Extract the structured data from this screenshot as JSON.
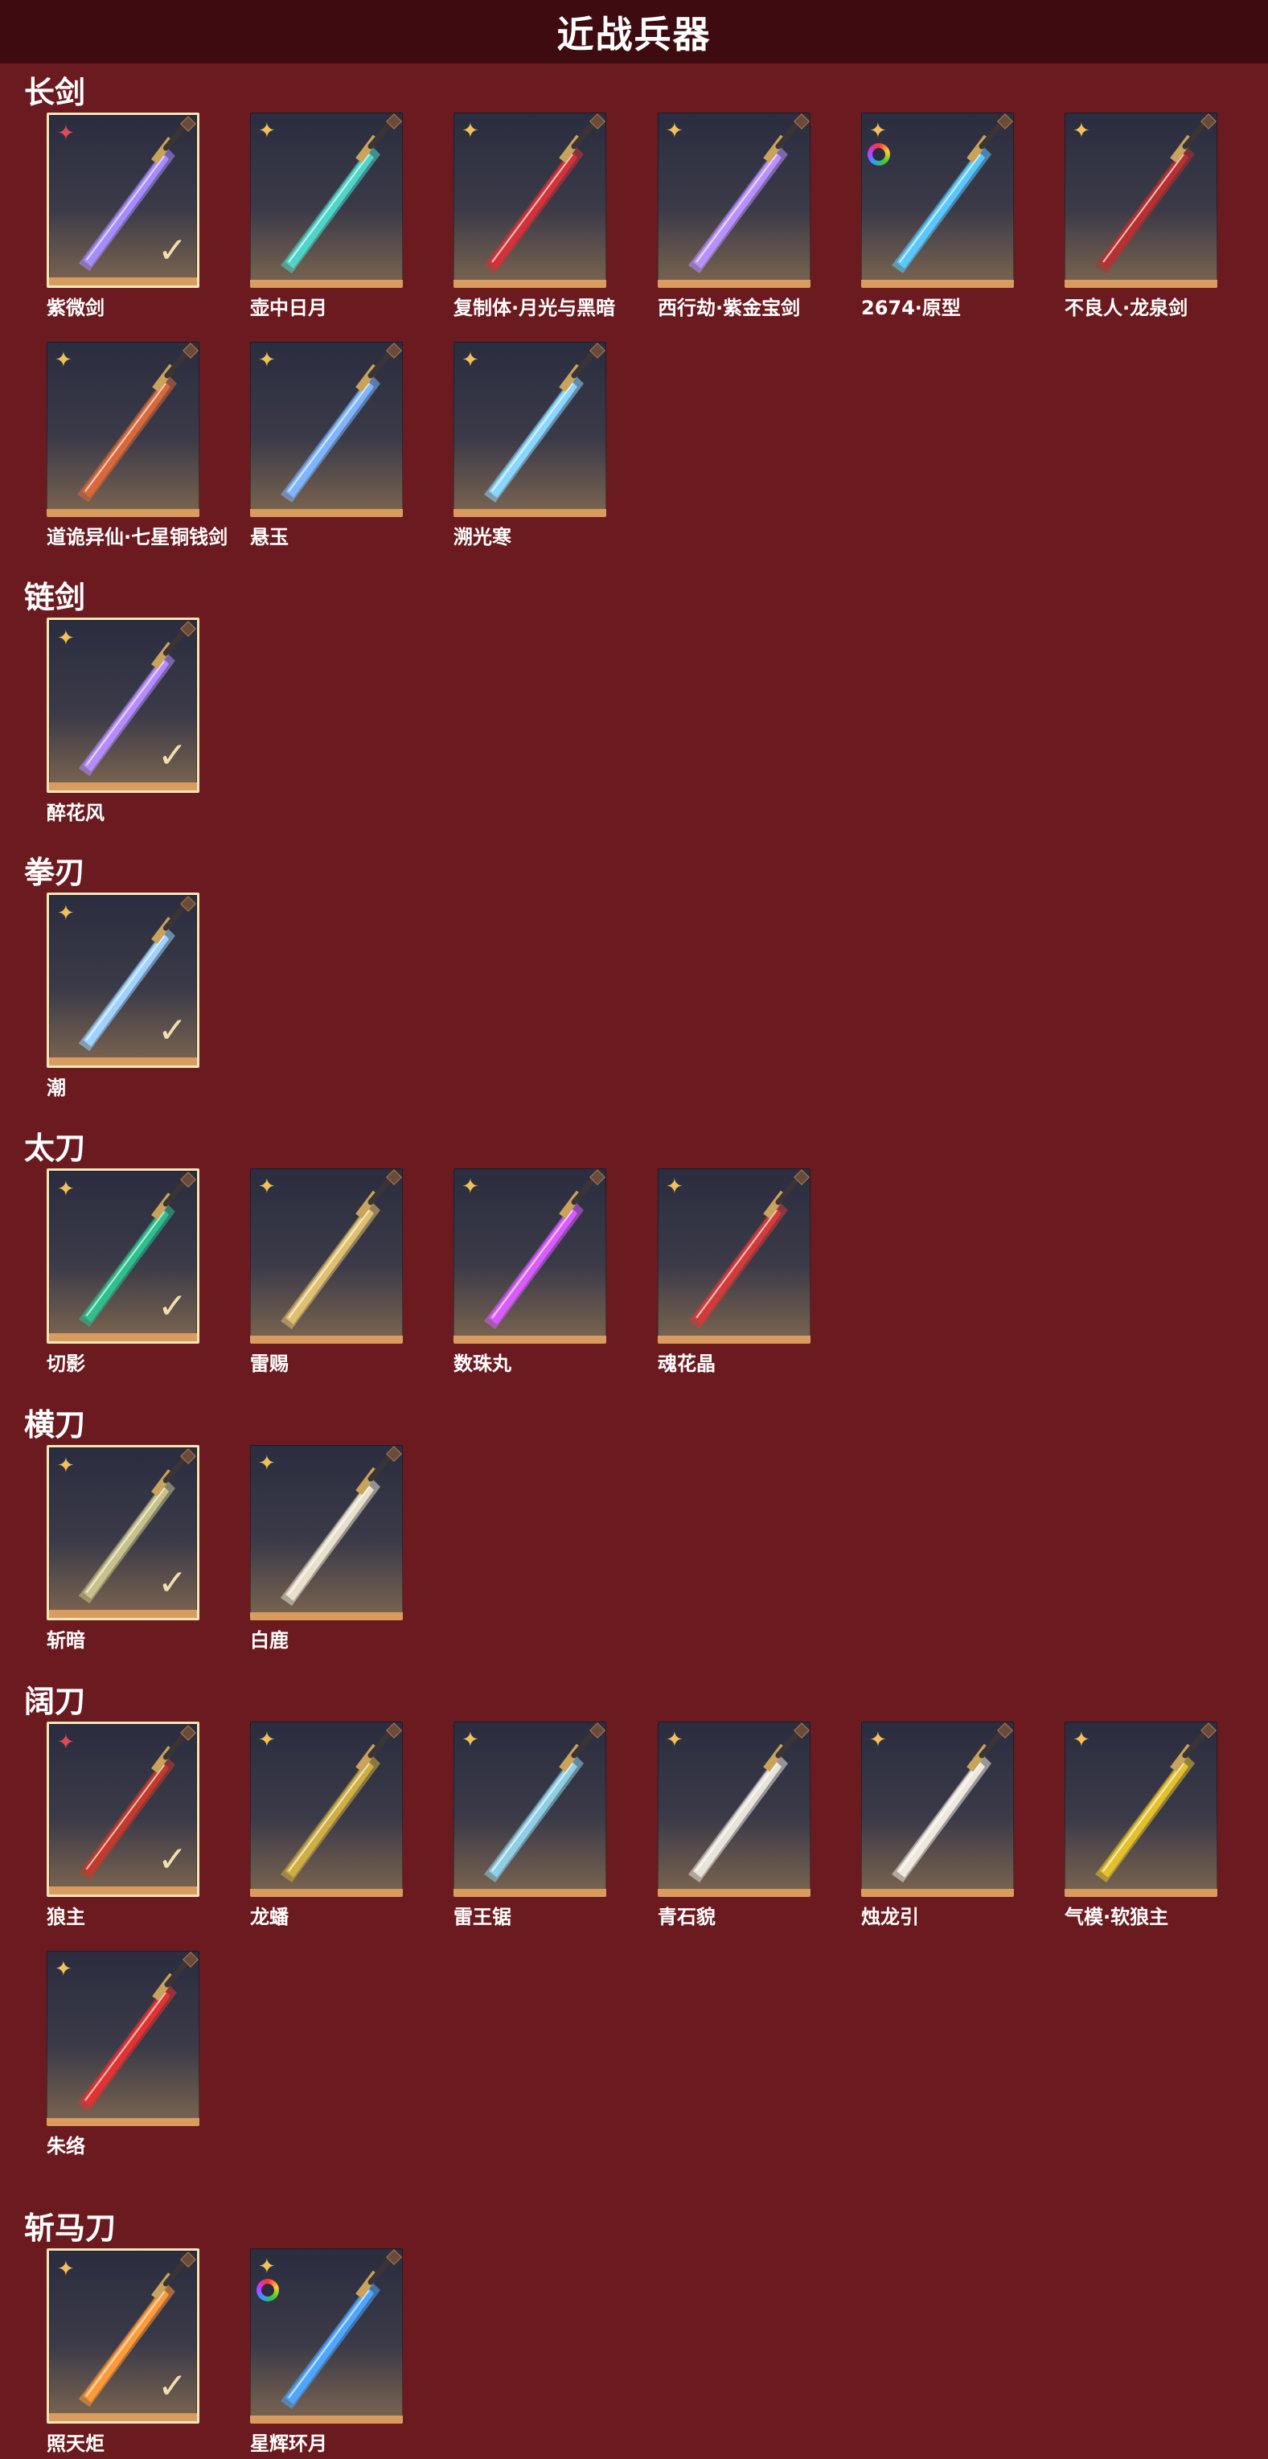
{
  "title": "近战兵器",
  "icons": {
    "rarity": "star-rarity-icon",
    "selected": "check-mark-icon",
    "ring": "rainbow-ring-icon"
  },
  "colors": {
    "background": "#6b1a1f",
    "header": "#3e0b10",
    "stripe": "#d99c5e",
    "check": "#f2dfb0",
    "rarity_gold": "#f1c05a",
    "rarity_red": "#e0495a"
  },
  "sections": [
    {
      "title": "长剑",
      "items": [
        {
          "name": "紫微剑",
          "rarity": "red",
          "selected": true,
          "ring": false,
          "color": "#a58cff"
        },
        {
          "name": "壶中日月",
          "rarity": "gold",
          "selected": false,
          "ring": false,
          "color": "#4fd5c8"
        },
        {
          "name": "复制体·月光与黑暗",
          "rarity": "gold",
          "selected": false,
          "ring": false,
          "color": "#d23238"
        },
        {
          "name": "西行劫·紫金宝剑",
          "rarity": "gold",
          "selected": false,
          "ring": false,
          "color": "#b891ff"
        },
        {
          "name": "2674·原型",
          "rarity": "gold",
          "selected": false,
          "ring": true,
          "color": "#5ac8ff"
        },
        {
          "name": "不良人·龙泉剑",
          "rarity": "gold",
          "selected": false,
          "ring": false,
          "color": "#b73030"
        },
        {
          "name": "道诡异仙·七星铜钱剑",
          "rarity": "gold",
          "selected": false,
          "ring": false,
          "color": "#d9683a"
        },
        {
          "name": "悬玉",
          "rarity": "gold",
          "selected": false,
          "ring": false,
          "color": "#7fb4ff"
        },
        {
          "name": "溯光寒",
          "rarity": "gold",
          "selected": false,
          "ring": false,
          "color": "#8ad6ff"
        }
      ]
    },
    {
      "title": "链剑",
      "items": [
        {
          "name": "醉花风",
          "rarity": "gold",
          "selected": true,
          "ring": false,
          "color": "#b58cff"
        }
      ]
    },
    {
      "title": "拳刃",
      "items": [
        {
          "name": "潮",
          "rarity": "gold",
          "selected": true,
          "ring": false,
          "color": "#9fd2ff"
        }
      ]
    },
    {
      "title": "太刀",
      "items": [
        {
          "name": "切影",
          "rarity": "gold",
          "selected": true,
          "ring": false,
          "color": "#2fbf8f"
        },
        {
          "name": "雷赐",
          "rarity": "gold",
          "selected": false,
          "ring": false,
          "color": "#e0c070"
        },
        {
          "name": "数珠丸",
          "rarity": "gold",
          "selected": false,
          "ring": false,
          "color": "#d85cff"
        },
        {
          "name": "魂花晶",
          "rarity": "gold",
          "selected": false,
          "ring": false,
          "color": "#d33a3a"
        }
      ]
    },
    {
      "title": "横刀",
      "items": [
        {
          "name": "斩暗",
          "rarity": "gold",
          "selected": true,
          "ring": false,
          "color": "#c7c28a"
        },
        {
          "name": "白鹿",
          "rarity": "gold",
          "selected": false,
          "ring": false,
          "color": "#e8e0cc"
        }
      ]
    },
    {
      "title": "阔刀",
      "items": [
        {
          "name": "狼主",
          "rarity": "red",
          "selected": true,
          "ring": false,
          "color": "#c23a2c"
        },
        {
          "name": "龙蟠",
          "rarity": "gold",
          "selected": false,
          "ring": false,
          "color": "#cfae43"
        },
        {
          "name": "雷王锯",
          "rarity": "gold",
          "selected": false,
          "ring": false,
          "color": "#8fcfe6"
        },
        {
          "name": "青石貌",
          "rarity": "gold",
          "selected": false,
          "ring": false,
          "color": "#e8e4dc"
        },
        {
          "name": "烛龙引",
          "rarity": "gold",
          "selected": false,
          "ring": false,
          "color": "#efe8df"
        },
        {
          "name": "气模·软狼主",
          "rarity": "gold",
          "selected": false,
          "ring": false,
          "color": "#e4c12c"
        },
        {
          "name": "朱络",
          "rarity": "gold",
          "selected": false,
          "ring": false,
          "color": "#e23232"
        }
      ]
    },
    {
      "title": "斩马刀",
      "items": [
        {
          "name": "照天炬",
          "rarity": "gold",
          "selected": true,
          "ring": false,
          "color": "#ff9a3a"
        },
        {
          "name": "星辉环月",
          "rarity": "gold",
          "selected": false,
          "ring": true,
          "color": "#4ea6ff"
        }
      ]
    }
  ]
}
